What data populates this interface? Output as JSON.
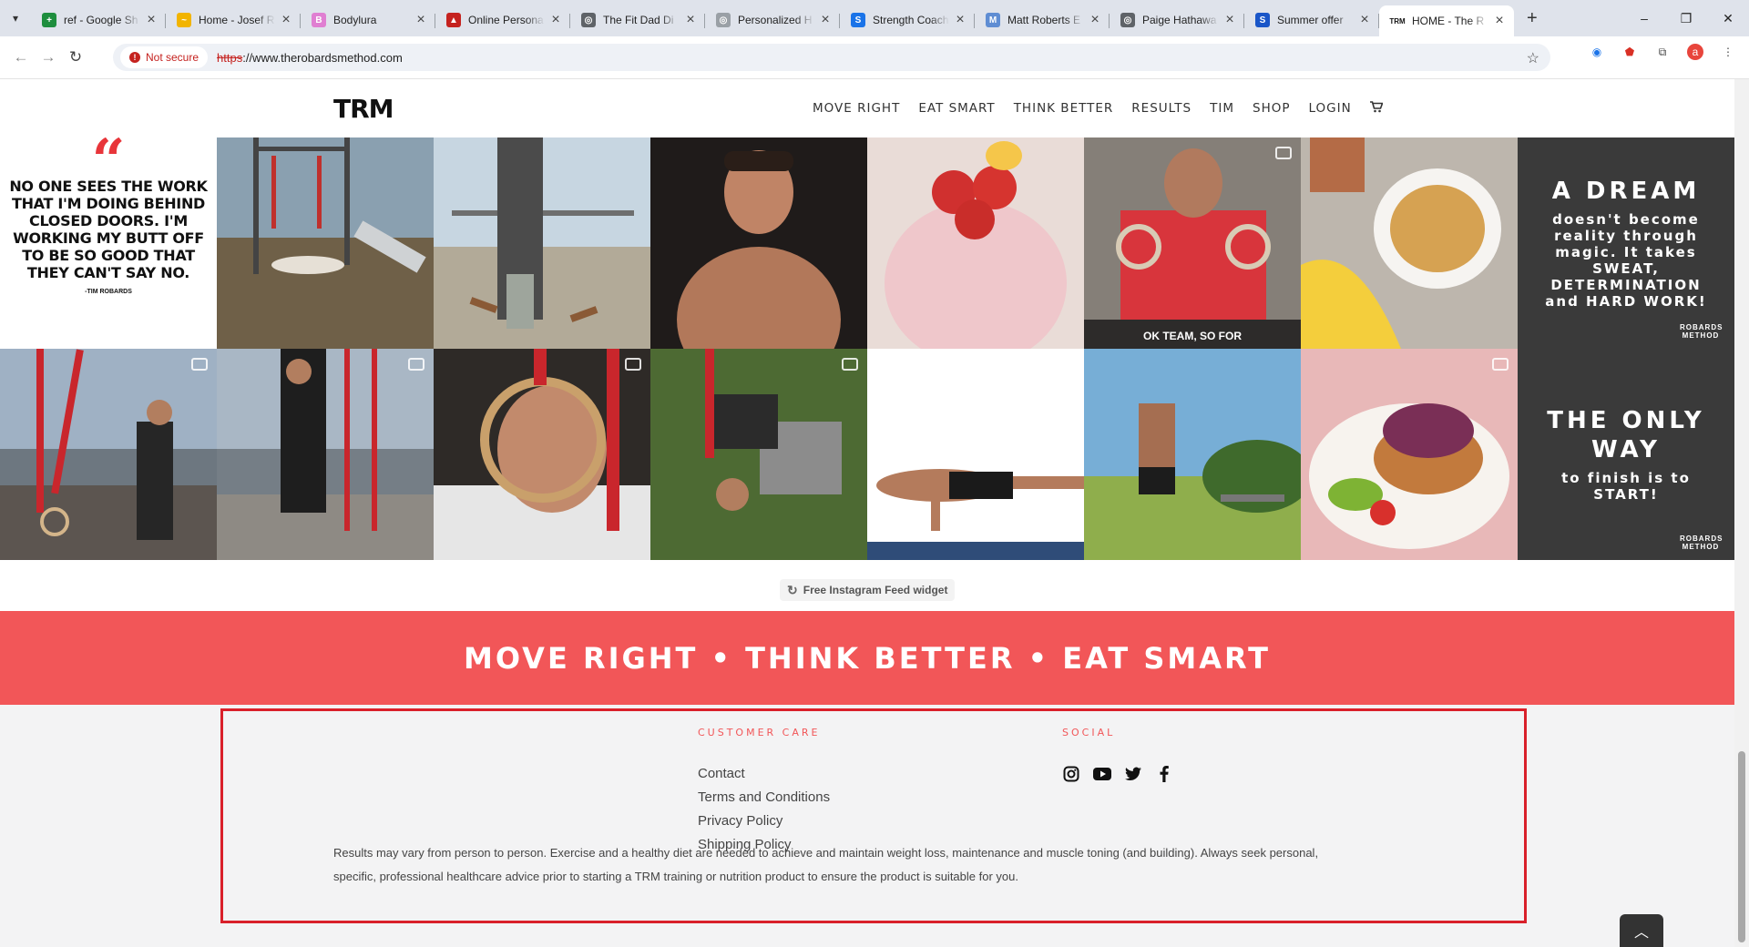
{
  "browser": {
    "tabs": [
      {
        "title": "ref - Google Sh",
        "favicon_color": "#1e8e3e",
        "glyph": "+"
      },
      {
        "title": "Home - Josef R",
        "favicon_color": "#f2b400",
        "glyph": "~"
      },
      {
        "title": "Bodylura",
        "favicon_color": "#e07fd2",
        "glyph": "B"
      },
      {
        "title": "Online Persona",
        "favicon_color": "#c5221f",
        "glyph": "▲"
      },
      {
        "title": "The Fit Dad Di",
        "favicon_color": "#5f6368",
        "glyph": "◎"
      },
      {
        "title": "Personalized H",
        "favicon_color": "#9aa0a6",
        "glyph": "◎"
      },
      {
        "title": "Strength Coach",
        "favicon_color": "#1a73e8",
        "glyph": "S"
      },
      {
        "title": "Matt Roberts E",
        "favicon_color": "#5f8dd3",
        "glyph": "M"
      },
      {
        "title": "Paige Hathawa",
        "favicon_color": "#5f6368",
        "glyph": "◎"
      },
      {
        "title": "Summer offer",
        "favicon_color": "#1a56c8",
        "glyph": "S"
      },
      {
        "title": "HOME - The R",
        "favicon_color": "#111111",
        "glyph": "TRM",
        "active": true
      }
    ],
    "new_tab": "+",
    "window_controls": [
      "–",
      "❐",
      "✕"
    ],
    "security_label": "Not secure",
    "url_scheme": "https",
    "url_rest": "://www.therobardsmethod.com"
  },
  "site": {
    "logo": "TRM",
    "menu": [
      "MOVE RIGHT",
      "EAT SMART",
      "THINK BETTER",
      "RESULTS",
      "TIM",
      "SHOP",
      "LOGIN"
    ],
    "cart_icon": "cart-icon"
  },
  "instagram": {
    "quote": {
      "mark": "“",
      "text": "NO ONE SEES THE WORK THAT I'M DOING BEHIND CLOSED DOORS. I'M WORKING MY BUTT OFF TO BE SO GOOD THAT THEY CAN'T SAY NO.",
      "author": "-TIM ROBARDS"
    },
    "dream": {
      "title": "A DREAM",
      "text": "doesn't become reality through magic. It takes SWEAT, DETERMINATION and HARD WORK!",
      "mark": "ROBARDS METHOD"
    },
    "only_way": {
      "title": "THE ONLY WAY",
      "text": "to finish is to START!",
      "mark": "ROBARDS METHOD"
    },
    "caption_overlay": "OK TEAM, SO FOR",
    "tiles": [
      {
        "name": "tile-park-pushup",
        "bg": "#6b7d5a"
      },
      {
        "name": "tile-handstand",
        "bg": "#b7c0c7"
      },
      {
        "name": "tile-shirtless-portrait",
        "bg": "#2a2422"
      },
      {
        "name": "tile-strawberry-smoothie",
        "bg": "#e2c6c9"
      },
      {
        "name": "tile-rings-red-shirt",
        "bg": "#7b7672"
      },
      {
        "name": "tile-oats-banana",
        "bg": "#cfc4b3"
      },
      {
        "name": "tile-trx-balcony",
        "bg": "#6a7785"
      },
      {
        "name": "tile-trx-lunge",
        "bg": "#8793a0"
      },
      {
        "name": "tile-rings-portrait",
        "bg": "#3c3733"
      },
      {
        "name": "tile-trx-pike",
        "bg": "#5e7a3e"
      },
      {
        "name": "tile-pushup-white",
        "bg": "#f4f4f4"
      },
      {
        "name": "tile-jump-park",
        "bg": "#6da0c9"
      },
      {
        "name": "tile-pancakes",
        "bg": "#c88a69"
      }
    ],
    "widget_label": "Free Instagram Feed widget"
  },
  "banner": {
    "text": "MOVE RIGHT • THINK BETTER • EAT SMART",
    "color": "#f25658"
  },
  "footer": {
    "customer_care_heading": "CUSTOMER CARE",
    "links": [
      "Contact",
      "Terms and Conditions",
      "Privacy Policy",
      "Shipping Policy"
    ],
    "social_heading": "SOCIAL",
    "social_icons": [
      "instagram-icon",
      "youtube-icon",
      "twitter-icon",
      "facebook-icon"
    ],
    "disclaimer": "Results may vary from person to person. Exercise and a healthy diet are needed to achieve and maintain weight loss, maintenance and muscle toning (and building). Always seek personal, specific, professional healthcare advice prior to starting a TRM training or nutrition product to ensure the product is suitable for you.",
    "highlight_color": "#d9202a"
  },
  "scroll_top_icon": "chevron-up-icon"
}
